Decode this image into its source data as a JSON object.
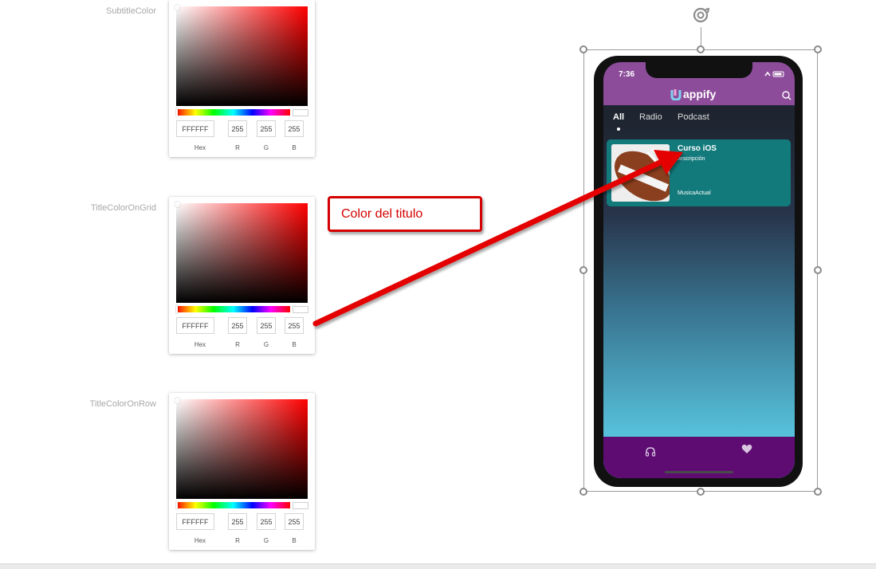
{
  "properties": [
    {
      "label": "SubtitleColor",
      "hex": "FFFFFF",
      "r": "255",
      "g": "255",
      "b": "255"
    },
    {
      "label": "TitleColorOnGrid",
      "hex": "FFFFFF",
      "r": "255",
      "g": "255",
      "b": "255"
    },
    {
      "label": "TitleColorOnRow",
      "hex": "FFFFFF",
      "r": "255",
      "g": "255",
      "b": "255"
    }
  ],
  "field_labels": {
    "hex": "Hex",
    "r": "R",
    "g": "G",
    "b": "B"
  },
  "callout": {
    "text": "Color del titulo",
    "color": "#d40000"
  },
  "phone": {
    "time": "7:36",
    "app_name": "appify",
    "tabs": [
      {
        "label": "All",
        "active": true
      },
      {
        "label": "Radio",
        "active": false
      },
      {
        "label": "Podcast",
        "active": false
      }
    ],
    "card": {
      "title": "Curso iOS",
      "description": "Descripción",
      "source": "MusicaActual"
    },
    "bottom_nav": [
      {
        "icon": "headphones-icon"
      },
      {
        "icon": "heart-icon"
      }
    ],
    "colors": {
      "header": "#8c4c9a",
      "card": "#137a7c",
      "bottom_bar": "#5e0c72"
    }
  }
}
